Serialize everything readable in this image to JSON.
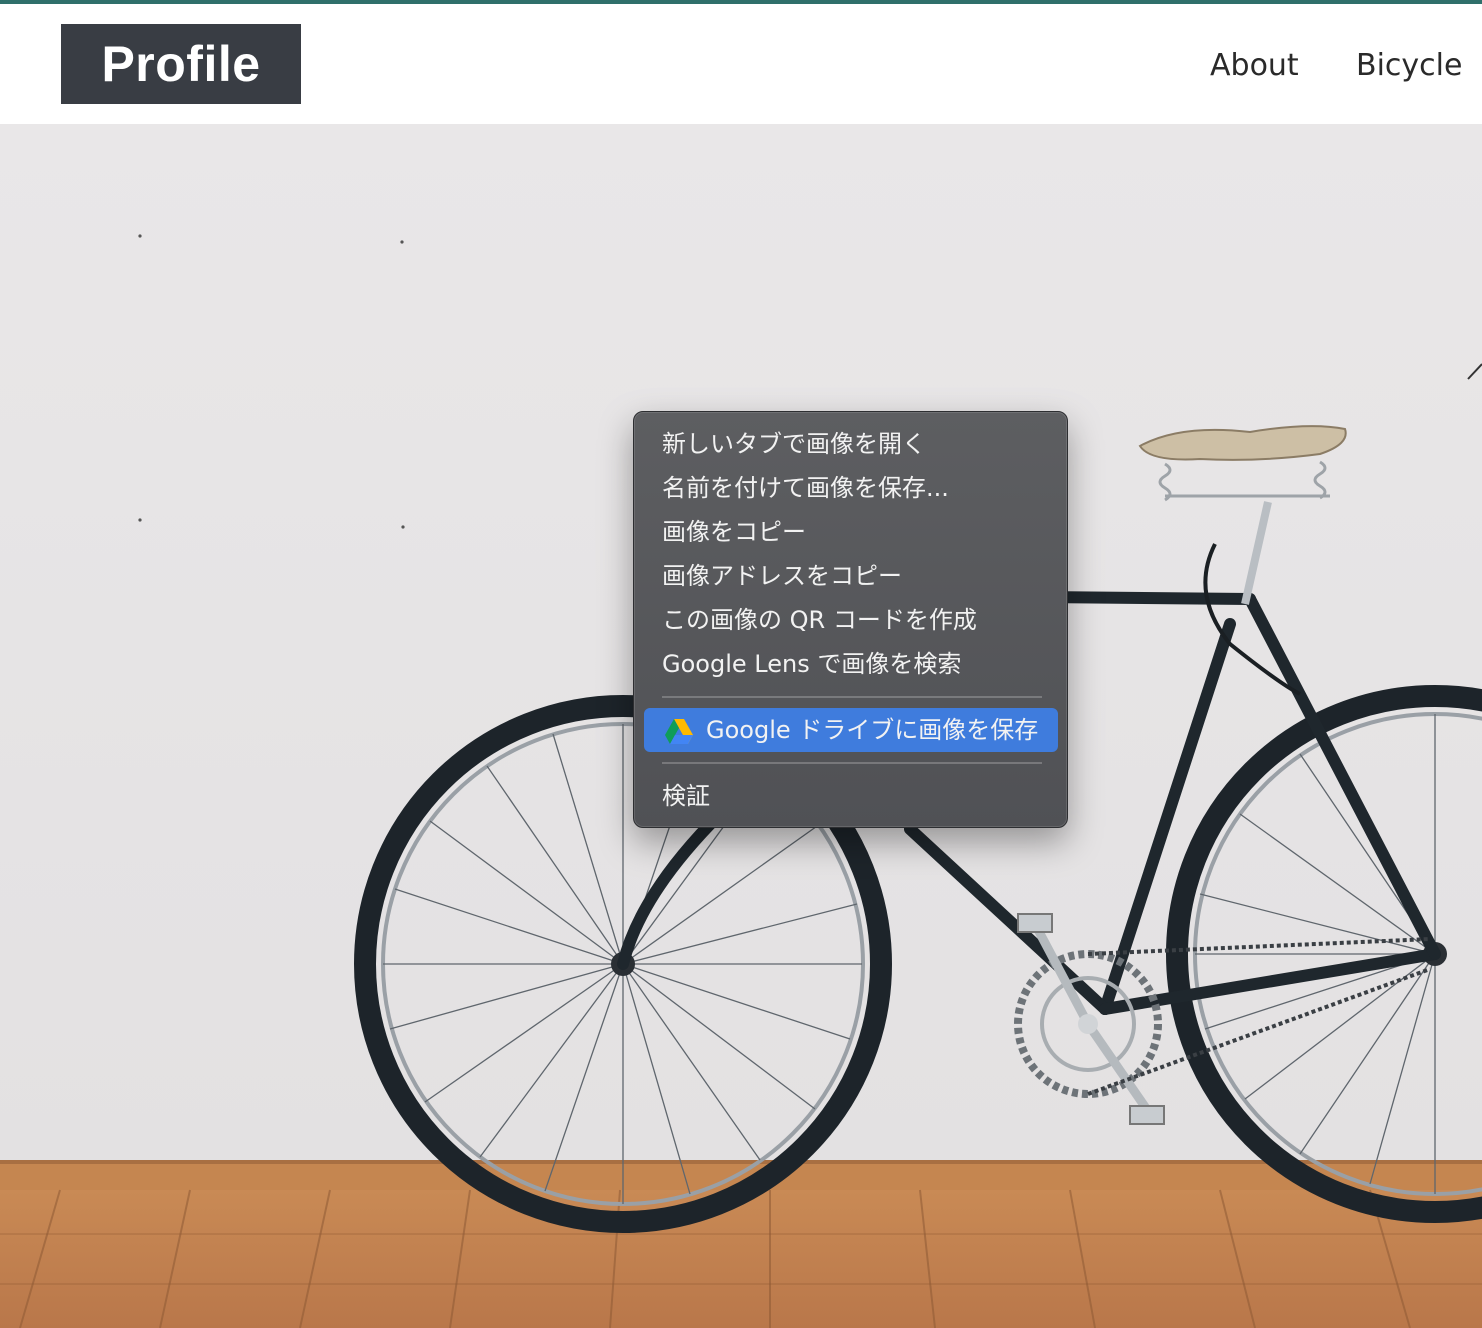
{
  "header": {
    "logo": "Profile",
    "nav": [
      {
        "label": "About"
      },
      {
        "label": "Bicycle"
      }
    ]
  },
  "hero": {
    "image_alt": "Bicycle leaning against a white wall on a wooden floor"
  },
  "context_menu": {
    "items": [
      {
        "label": "新しいタブで画像を開く"
      },
      {
        "label": "名前を付けて画像を保存..."
      },
      {
        "label": "画像をコピー"
      },
      {
        "label": "画像アドレスをコピー"
      },
      {
        "label": "この画像の QR コードを作成"
      },
      {
        "label": "Google Lens で画像を検索"
      }
    ],
    "drive_item": {
      "label": "Google ドライブに画像を保存",
      "icon": "google-drive-icon",
      "highlighted": true
    },
    "inspect_item": {
      "label": "検証"
    },
    "highlight_color": "#3f7cdd"
  }
}
